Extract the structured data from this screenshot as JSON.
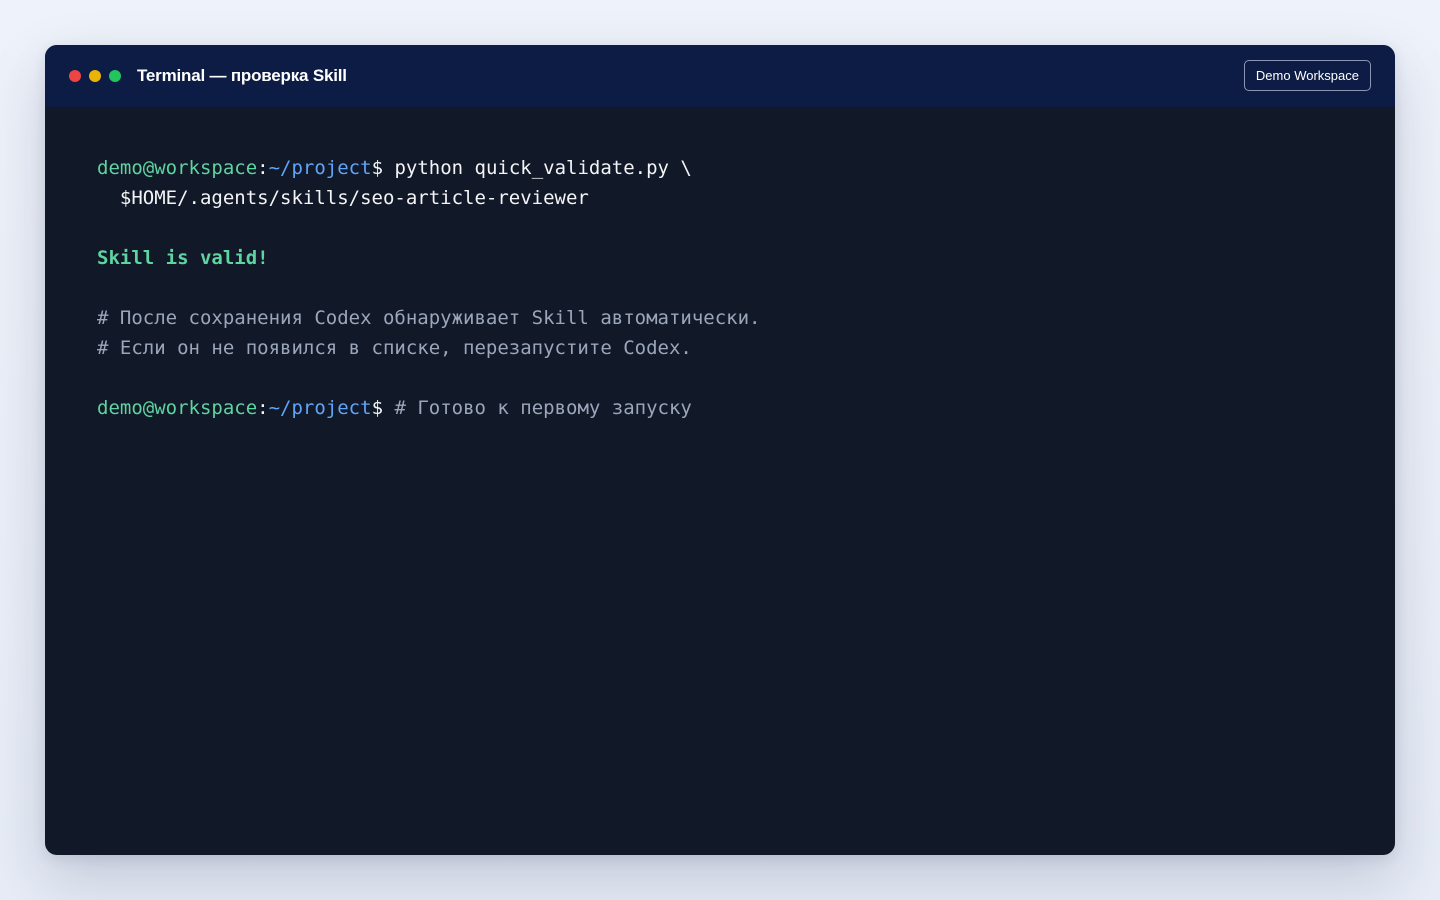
{
  "window": {
    "title": "Terminal — проверка Skill",
    "workspace_button": "Demo Workspace"
  },
  "colors": {
    "close": "#ef4444",
    "minimize": "#eab308",
    "maximize": "#22c55e",
    "titlebar_bg": "#0c1c44",
    "terminal_bg": "#111827",
    "prompt_user": "#5fd3a0",
    "prompt_path": "#60a5fa",
    "comment": "#9aa6ba"
  },
  "terminal": {
    "prompt": {
      "user_host": "demo@workspace",
      "colon": ":",
      "path": "~/project",
      "symbol": "$"
    },
    "command_line_1": " python quick_validate.py \\",
    "command_line_2": "  $HOME/.agents/skills/seo-article-reviewer",
    "success_message": "Skill is valid!",
    "comment_1": "# После сохранения Codex обнаруживает Skill автоматически.",
    "comment_2": "# Если он не появился в списке, перезапустите Codex.",
    "final_comment": " # Готово к первому запуску"
  }
}
